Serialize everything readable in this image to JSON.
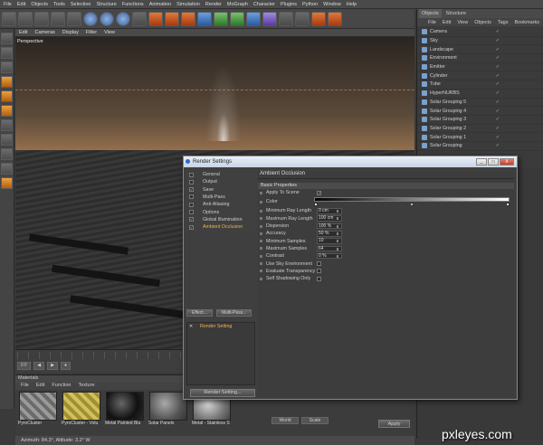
{
  "menubar": [
    "File",
    "Edit",
    "Objects",
    "Tools",
    "Selection",
    "Structure",
    "Functions",
    "Animation",
    "Simulation",
    "Render",
    "MoGraph",
    "Character",
    "Plugins",
    "Python",
    "Window",
    "Help"
  ],
  "toolbar": {
    "axis_labels": [
      "X",
      "Y",
      "Z"
    ]
  },
  "viewport": {
    "menu": [
      "Edit",
      "Cameras",
      "Display",
      "Filter",
      "View"
    ],
    "label": "Perspective"
  },
  "timeline": {
    "frame": "0 F"
  },
  "materials": {
    "title": "Materials",
    "menu": [
      "File",
      "Edit",
      "Function",
      "Texture"
    ],
    "items": [
      "PyroCluster",
      "PyroCluster - Volu",
      "Metal Painted Bla",
      "Solar Panels",
      "Metal - Stainless S"
    ]
  },
  "statusbar": "Azimuth: 84.3°, Altitude: 3.2° W",
  "objects": {
    "tabs": [
      "Objects",
      "Structure"
    ],
    "menu": [
      "File",
      "Edit",
      "View",
      "Objects",
      "Tags",
      "Bookmarks"
    ],
    "items": [
      "Camera",
      "Sky",
      "Landscape",
      "Environment",
      "Emitter",
      "Cylinder",
      "Tube",
      "HyperNURBS",
      "Solar Grouping 5",
      "Solar Grouping 4",
      "Solar Grouping 3",
      "Solar Grouping 2",
      "Solar Grouping 1",
      "Solar Grouping"
    ]
  },
  "attributes": {
    "apply_label": "Apply",
    "mode_a": "World",
    "mode_b": "Scale"
  },
  "dialog": {
    "title": "Render Settings",
    "nav": [
      {
        "label": "General",
        "checked": false
      },
      {
        "label": "Output",
        "checked": false
      },
      {
        "label": "Save",
        "checked": true
      },
      {
        "label": "Multi-Pass",
        "checked": false
      },
      {
        "label": "Anti-Aliasing",
        "checked": false
      },
      {
        "label": "Options",
        "checked": false
      },
      {
        "label": "Global Illumination",
        "checked": true
      },
      {
        "label": "Ambient Occlusion",
        "checked": true
      }
    ],
    "effect_btn": "Effect...",
    "multipass_btn": "Multi-Pass...",
    "render_setting_item": "Render Setting",
    "render_setting_btn": "Render Setting...",
    "section_title": "Ambient Occlusion",
    "subsection": "Basic Properties",
    "apply_to_scene": "Apply To Scene",
    "color": "Color",
    "params": [
      {
        "label": "Minimum Ray Length",
        "value": "0 cm"
      },
      {
        "label": "Maximum Ray Length",
        "value": "100 cm"
      },
      {
        "label": "Dispersion",
        "value": "100 %"
      },
      {
        "label": "Accuracy",
        "value": "50 %"
      },
      {
        "label": "Minimum Samples",
        "value": "10"
      },
      {
        "label": "Maximum Samples",
        "value": "64"
      },
      {
        "label": "Contrast",
        "value": "0 %"
      }
    ],
    "checks": [
      "Use Sky Environment",
      "Evaluate Transparency",
      "Self Shadowing Only"
    ],
    "controls": [
      "_",
      "□",
      "X"
    ]
  },
  "watermark": "pxleyes.com"
}
